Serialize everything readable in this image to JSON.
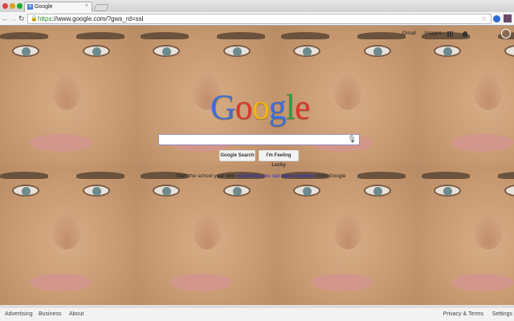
{
  "browser": {
    "tab_title": "Google",
    "tab_favicon": "8",
    "url_scheme": "https",
    "url_rest": "://www.google.com/?gws_rd=ssl"
  },
  "topnav": {
    "gmail": "Gmail",
    "images": "Images"
  },
  "logo": {
    "letters": [
      "G",
      "o",
      "o",
      "g",
      "l",
      "e"
    ],
    "colors": [
      "#3b6fd8",
      "#d8392c",
      "#f2b50f",
      "#3b6fd8",
      "#2e9d44",
      "#d8392c"
    ]
  },
  "search": {
    "placeholder": "",
    "mic_icon": "🎙"
  },
  "buttons": {
    "search": "Google Search",
    "lucky": "I'm Feeling Lucky"
  },
  "promo": {
    "before": "Start the school year with ",
    "link": "notebooks you can take anywhere",
    "after": " from Google"
  },
  "footer": {
    "advertising": "Advertising",
    "business": "Business",
    "about": "About",
    "privacy": "Privacy & Terms",
    "settings": "Settings"
  }
}
